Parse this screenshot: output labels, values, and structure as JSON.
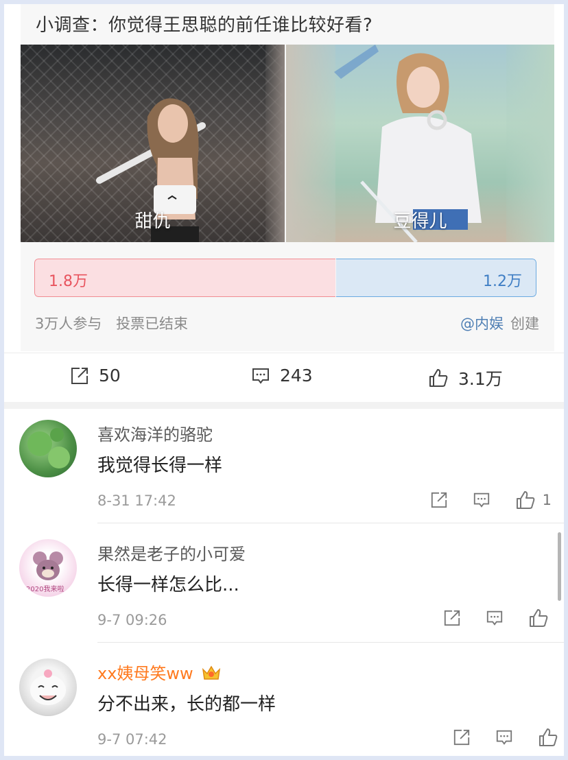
{
  "poll": {
    "title": "小调查：你觉得王思聪的前任谁比较好看?",
    "options": [
      {
        "label": "甜仇",
        "votes_text": "1.8万",
        "share": 0.6
      },
      {
        "label": "豆得儿",
        "votes_text": "1.2万",
        "share": 0.4
      }
    ],
    "participants": "3万人参与",
    "status": "投票已结束",
    "creator_link": "@内娱",
    "creator_suffix": "创建"
  },
  "actions": {
    "repost_count": "50",
    "comment_count": "243",
    "like_count": "3.1万"
  },
  "comments": [
    {
      "user": "喜欢海洋的骆驼",
      "text": "我觉得长得一样",
      "time": "8-31 17:42",
      "likes": "1"
    },
    {
      "user": "果然是老子的小可爱",
      "text": "长得一样怎么比...",
      "time": "9-7 09:26",
      "likes": "",
      "avatar_text": "2020我来啦"
    },
    {
      "user": "xx姨母笑ww",
      "text": "分不出来，长的都一样",
      "time": "9-7 07:42",
      "likes": ""
    }
  ],
  "colors": {
    "vote_left": "#e8545e",
    "vote_right": "#3f7ec4",
    "link": "#4f7fb4",
    "vip_name": "#ff7a1f"
  },
  "icons": [
    "repost-icon",
    "comment-icon",
    "like-icon",
    "crown-badge-icon"
  ]
}
